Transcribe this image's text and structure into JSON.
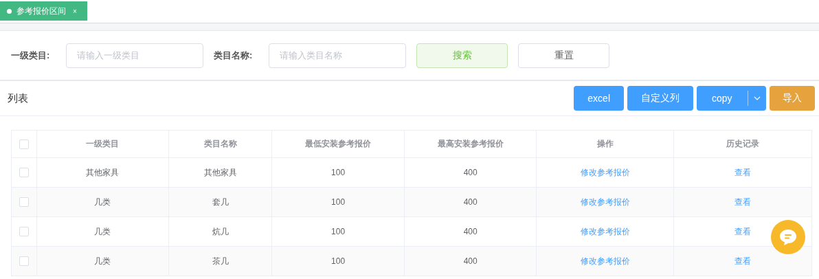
{
  "tabs": [
    {
      "label": "参考报价区间",
      "selected": true,
      "close": "×"
    }
  ],
  "filters": [
    {
      "label": "一级类目:",
      "placeholder": "请输入一级类目"
    },
    {
      "label": "类目名称:",
      "placeholder": "请输入类目名称"
    }
  ],
  "filter_buttons": [
    {
      "label": "搜索",
      "kind": "primary"
    },
    {
      "label": "重置",
      "kind": "plain"
    }
  ],
  "list_title": "列表",
  "toolbar_buttons": [
    {
      "label": "excel",
      "kind": "blue"
    },
    {
      "label": "自定义列",
      "kind": "blue"
    },
    {
      "label": "copy",
      "kind": "split"
    },
    {
      "label": "导入",
      "kind": "orange"
    }
  ],
  "table": {
    "select_all_checked": false,
    "columns": [
      "一级类目",
      "类目名称",
      "最低安装参考报价",
      "最高安装参考报价",
      "操作",
      "历史记录"
    ],
    "rows": [
      {
        "checked": false,
        "cells": [
          "其他家具",
          "其他家具",
          "100",
          "400"
        ],
        "action": "修改参考报价",
        "history": "查看"
      },
      {
        "checked": false,
        "cells": [
          "几类",
          "套几",
          "100",
          "400"
        ],
        "action": "修改参考报价",
        "history": "查看"
      },
      {
        "checked": false,
        "cells": [
          "几类",
          "炕几",
          "100",
          "400"
        ],
        "action": "修改参考报价",
        "history": "查看"
      },
      {
        "checked": false,
        "cells": [
          "几类",
          "茶几",
          "100",
          "400"
        ],
        "action": "修改参考报价",
        "history": "查看"
      }
    ]
  }
}
